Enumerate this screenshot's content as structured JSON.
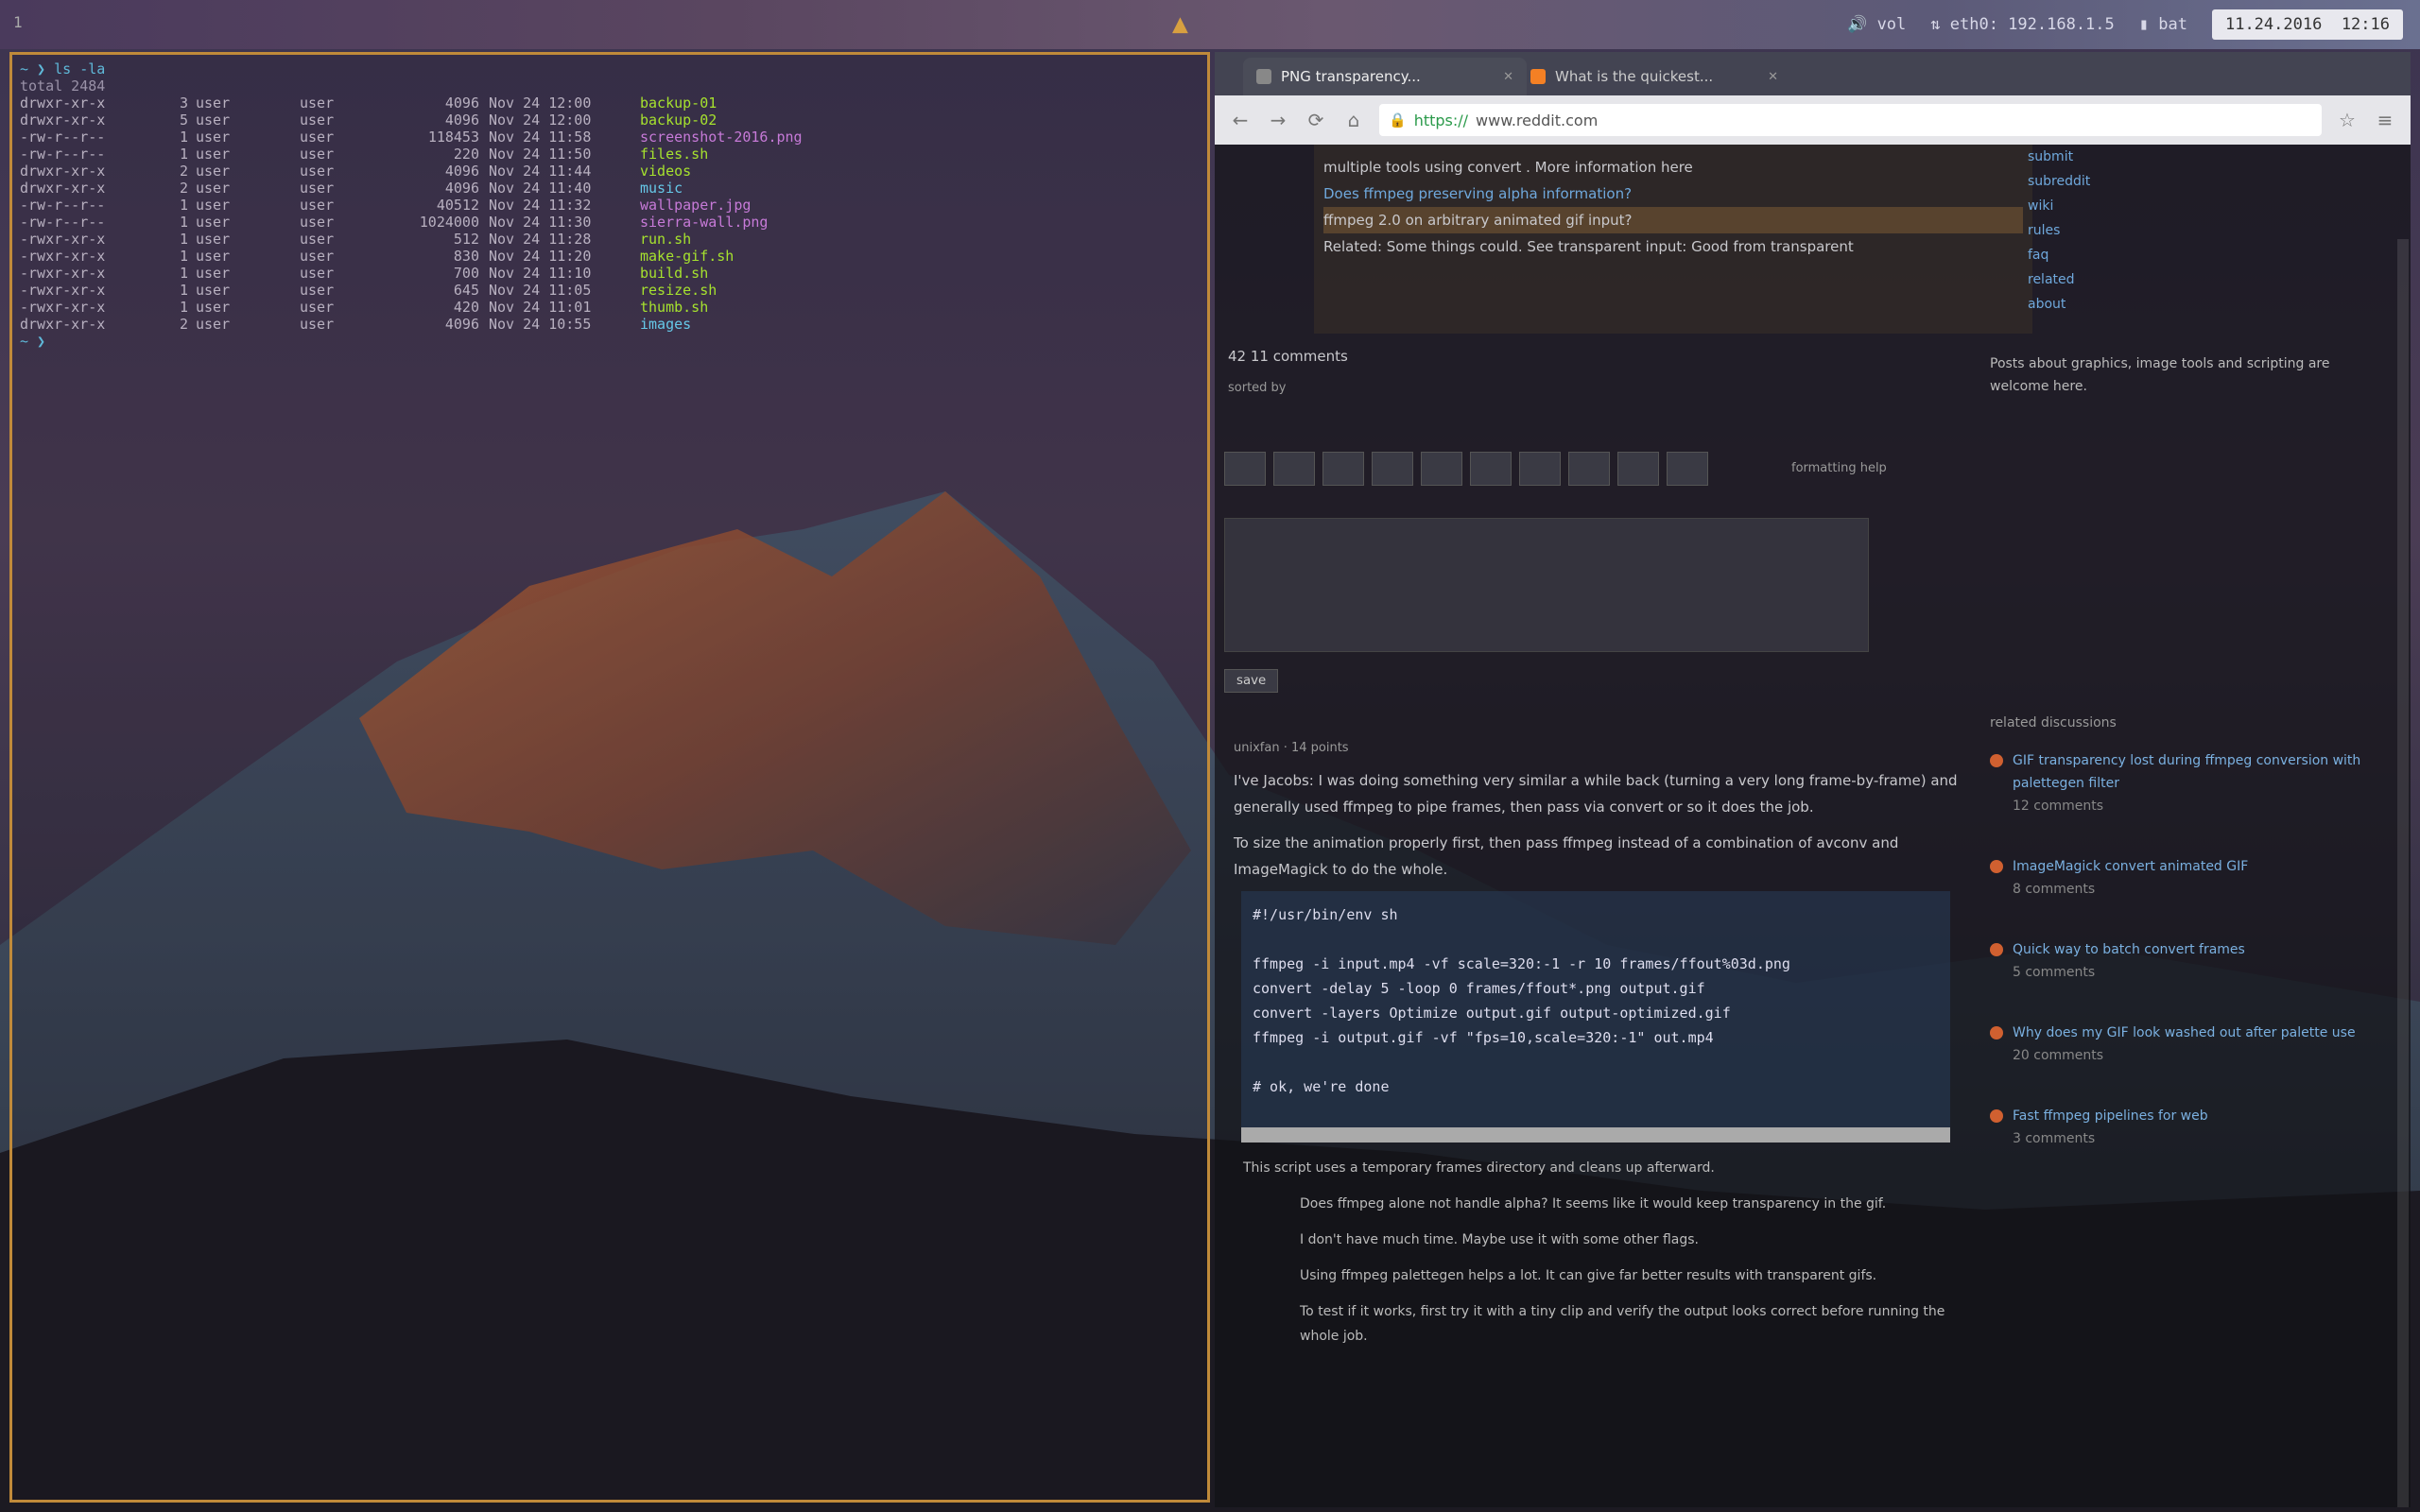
{
  "topbar": {
    "workspace": "1",
    "volume": "vol",
    "network": "eth0: 192.168.1.5",
    "battery": "bat",
    "clock_date": "11.24.2016",
    "clock_time": "12:16"
  },
  "terminal": {
    "prompt1": "~ ❯ ls -la",
    "header": "total 2484",
    "rows": [
      {
        "perm": "drwxr-xr-x",
        "n": "3",
        "user": "user",
        "group": "user",
        "size": "4096",
        "date": "Nov 24 12:00",
        "name": "backup-01",
        "cls": "exe"
      },
      {
        "perm": "drwxr-xr-x",
        "n": "5",
        "user": "user",
        "group": "user",
        "size": "4096",
        "date": "Nov 24 12:00",
        "name": "backup-02",
        "cls": "exe"
      },
      {
        "perm": "-rw-r--r--",
        "n": "1",
        "user": "user",
        "group": "user",
        "size": "118453",
        "date": "Nov 24 11:58",
        "name": "screenshot-2016.png",
        "cls": "img"
      },
      {
        "perm": "-rw-r--r--",
        "n": "1",
        "user": "user",
        "group": "user",
        "size": "220",
        "date": "Nov 24 11:50",
        "name": "files.sh",
        "cls": "exe"
      },
      {
        "perm": "drwxr-xr-x",
        "n": "2",
        "user": "user",
        "group": "user",
        "size": "4096",
        "date": "Nov 24 11:44",
        "name": "videos",
        "cls": "exe"
      },
      {
        "perm": "drwxr-xr-x",
        "n": "2",
        "user": "user",
        "group": "user",
        "size": "4096",
        "date": "Nov 24 11:40",
        "name": "music",
        "cls": "dir"
      },
      {
        "perm": "-rw-r--r--",
        "n": "1",
        "user": "user",
        "group": "user",
        "size": "40512",
        "date": "Nov 24 11:32",
        "name": "wallpaper.jpg",
        "cls": "link"
      },
      {
        "perm": "-rw-r--r--",
        "n": "1",
        "user": "user",
        "group": "user",
        "size": "1024000",
        "date": "Nov 24 11:30",
        "name": "sierra-wall.png",
        "cls": "link"
      },
      {
        "perm": "-rwxr-xr-x",
        "n": "1",
        "user": "user",
        "group": "user",
        "size": "512",
        "date": "Nov 24 11:28",
        "name": "run.sh",
        "cls": "exe"
      },
      {
        "perm": "-rwxr-xr-x",
        "n": "1",
        "user": "user",
        "group": "user",
        "size": "830",
        "date": "Nov 24 11:20",
        "name": "make-gif.sh",
        "cls": "exe"
      },
      {
        "perm": "-rwxr-xr-x",
        "n": "1",
        "user": "user",
        "group": "user",
        "size": "700",
        "date": "Nov 24 11:10",
        "name": "build.sh",
        "cls": "exe"
      },
      {
        "perm": "-rwxr-xr-x",
        "n": "1",
        "user": "user",
        "group": "user",
        "size": "645",
        "date": "Nov 24 11:05",
        "name": "resize.sh",
        "cls": "exe"
      },
      {
        "perm": "-rwxr-xr-x",
        "n": "1",
        "user": "user",
        "group": "user",
        "size": "420",
        "date": "Nov 24 11:01",
        "name": "thumb.sh",
        "cls": "exe"
      },
      {
        "perm": "drwxr-xr-x",
        "n": "2",
        "user": "user",
        "group": "user",
        "size": "4096",
        "date": "Nov 24 10:55",
        "name": "images",
        "cls": "dir"
      }
    ],
    "prompt2": "~ ❯"
  },
  "browser": {
    "tabs": [
      {
        "label": "PNG transparency...",
        "active": true
      },
      {
        "label": "What is the quickest...",
        "active": false
      },
      {
        "label": "",
        "active": false
      }
    ],
    "url_scheme": "https://",
    "url_host": "www.reddit.com",
    "page": {
      "q_line1": "multiple tools using convert . More information here",
      "q_line2": "Does ffmpeg preserving alpha information?",
      "q_line3": "ffmpeg 2.0 on arbitrary animated gif input?",
      "q_line4": "Related: Some things could. See transparent input: Good from transparent",
      "comments_header": "42 11 comments",
      "sort_label": "sorted by",
      "edit_label": "formatting help",
      "save_label": "save",
      "answer_author": "unixfan · 14 points",
      "answer_p1": "I've Jacobs: I was doing something very similar a while back (turning a very long frame-by-frame) and generally used ffmpeg to pipe frames, then pass via convert or so it does the job.",
      "answer_p2": "To size the animation properly first, then pass ffmpeg instead of a combination of avconv and ImageMagick to do the whole.",
      "code_lines": [
        "#!/usr/bin/env sh",
        "",
        "ffmpeg -i input.mp4 -vf scale=320:-1 -r 10 frames/ffout%03d.png",
        "convert -delay 5 -loop 0 frames/ffout*.png output.gif",
        "convert -layers Optimize output.gif output-optimized.gif",
        "ffmpeg -i output.gif -vf \"fps=10,scale=320:-1\" out.mp4",
        "",
        "# ok, we're done"
      ],
      "answer_note": "This script uses a temporary frames directory and cleans up afterward.",
      "comment1": "Does ffmpeg alone not handle alpha? It seems like it would keep transparency in the gif.",
      "comment2": "I don't have much time. Maybe use it with some other flags.",
      "comment3": "Using ffmpeg palettegen helps a lot. It can give far better results with transparent gifs.",
      "comment4": "To test if it works, first try it with a tiny clip and verify the output looks correct before running the whole job.",
      "side_items": [
        "submit",
        "subreddit",
        "wiki",
        "rules",
        "faq",
        "related",
        "about"
      ],
      "side_note": "Posts about graphics, image tools and scripting are welcome here.",
      "hot_header": "related discussions",
      "hot": [
        {
          "title": "GIF transparency lost during ffmpeg conversion with palettegen filter",
          "meta": "12 comments"
        },
        {
          "title": "ImageMagick convert animated GIF",
          "meta": "8 comments"
        },
        {
          "title": "Quick way to batch convert frames",
          "meta": "5 comments"
        },
        {
          "title": "Why does my GIF look washed out after palette use",
          "meta": "20 comments"
        },
        {
          "title": "Fast ffmpeg pipelines for web",
          "meta": "3 comments"
        }
      ]
    }
  },
  "colors": {
    "accent": "#c08a3a",
    "link": "#6fa8dc",
    "exe": "#a6e22e",
    "dir": "#66c8e8",
    "img": "#c77ad8"
  }
}
